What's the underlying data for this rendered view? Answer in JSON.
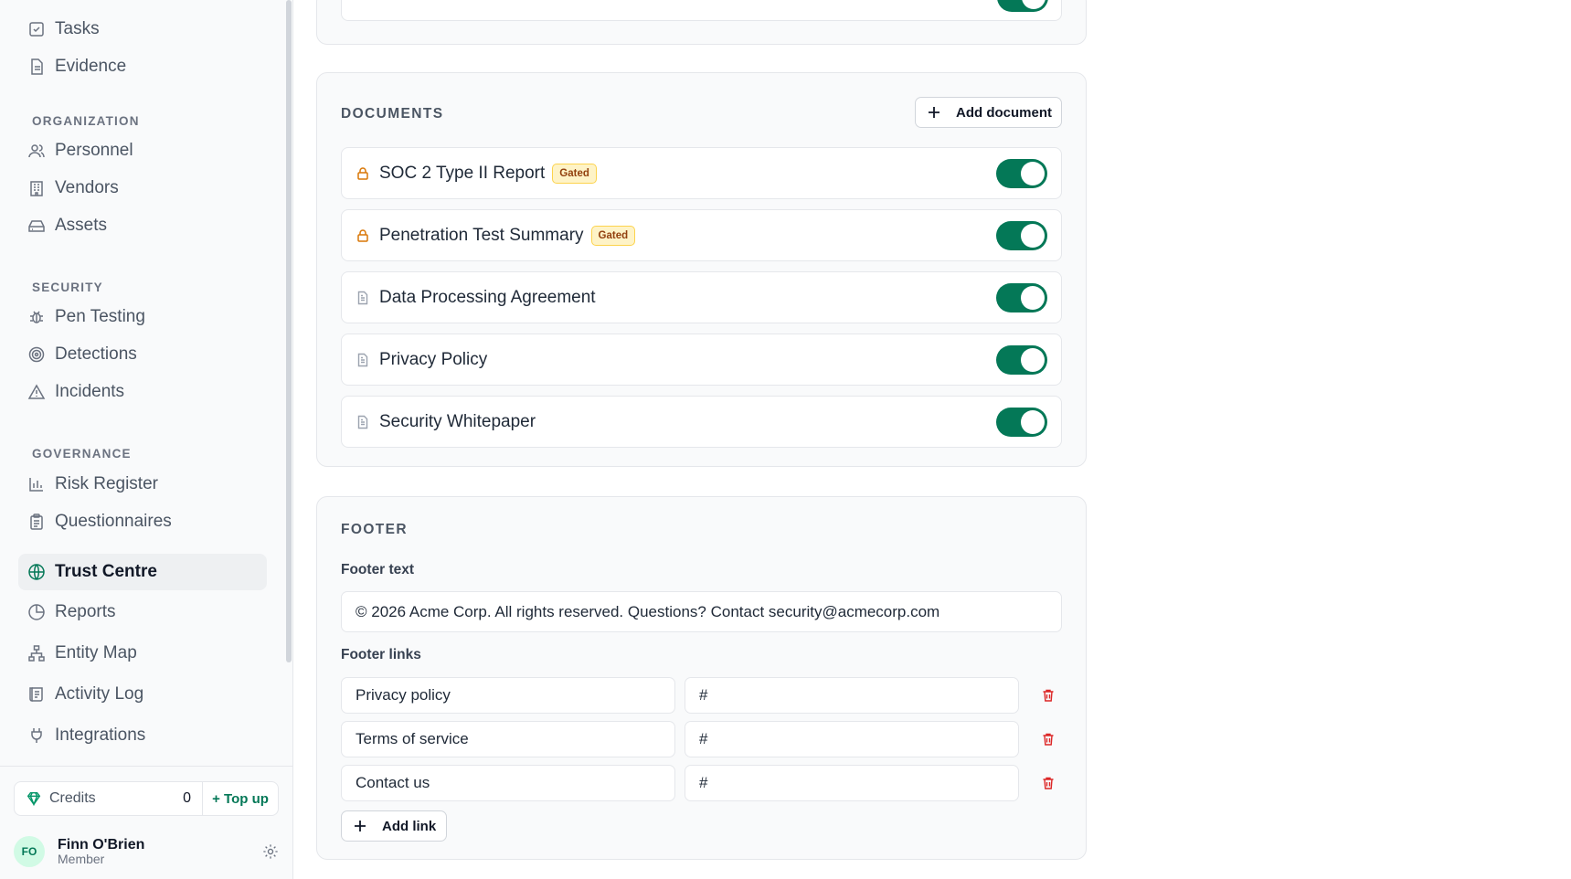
{
  "sidebar": {
    "items_top": [
      {
        "label": "Tasks",
        "icon": "checkbox-icon"
      },
      {
        "label": "Evidence",
        "icon": "file-icon"
      }
    ],
    "sections": {
      "organization": "ORGANIZATION",
      "security": "SECURITY",
      "governance": "GOVERNANCE"
    },
    "organization_items": [
      {
        "label": "Personnel",
        "icon": "users-icon"
      },
      {
        "label": "Vendors",
        "icon": "building-icon"
      },
      {
        "label": "Assets",
        "icon": "drive-icon"
      }
    ],
    "security_items": [
      {
        "label": "Pen Testing",
        "icon": "bug-icon"
      },
      {
        "label": "Detections",
        "icon": "radar-icon"
      },
      {
        "label": "Incidents",
        "icon": "warning-icon"
      }
    ],
    "governance_items": [
      {
        "label": "Risk Register",
        "icon": "bar-chart-icon"
      },
      {
        "label": "Questionnaires",
        "icon": "clipboard-icon"
      },
      {
        "label": "Trust Centre",
        "icon": "globe-icon",
        "active": true
      },
      {
        "label": "Reports",
        "icon": "pie-chart-icon"
      },
      {
        "label": "Entity Map",
        "icon": "network-icon"
      },
      {
        "label": "Activity Log",
        "icon": "scroll-icon"
      },
      {
        "label": "Integrations",
        "icon": "plug-icon"
      }
    ],
    "credits": {
      "label": "Credits",
      "count": "0",
      "topup": "+ Top up"
    },
    "user": {
      "initials": "FO",
      "name": "Finn O'Brien",
      "role": "Member"
    }
  },
  "documents": {
    "title": "DOCUMENTS",
    "add_label": "Add document",
    "items": [
      {
        "name": "SOC 2 Type II Report",
        "gated": true,
        "badge": "Gated",
        "enabled": true
      },
      {
        "name": "Penetration Test Summary",
        "gated": true,
        "badge": "Gated",
        "enabled": true
      },
      {
        "name": "Data Processing Agreement",
        "gated": false,
        "enabled": true
      },
      {
        "name": "Privacy Policy",
        "gated": false,
        "enabled": true
      },
      {
        "name": "Security Whitepaper",
        "gated": false,
        "enabled": true
      }
    ]
  },
  "footer": {
    "title": "FOOTER",
    "text_label": "Footer text",
    "text_value": "© 2026 Acme Corp. All rights reserved. Questions? Contact security@acmecorp.com",
    "links_label": "Footer links",
    "links": [
      {
        "label": "Privacy policy",
        "url": "#"
      },
      {
        "label": "Terms of service",
        "url": "#"
      },
      {
        "label": "Contact us",
        "url": "#"
      }
    ],
    "add_link_label": "Add link"
  },
  "colors": {
    "accent": "#047857",
    "gated_badge": "#fef3c7",
    "danger": "#dc2626"
  }
}
